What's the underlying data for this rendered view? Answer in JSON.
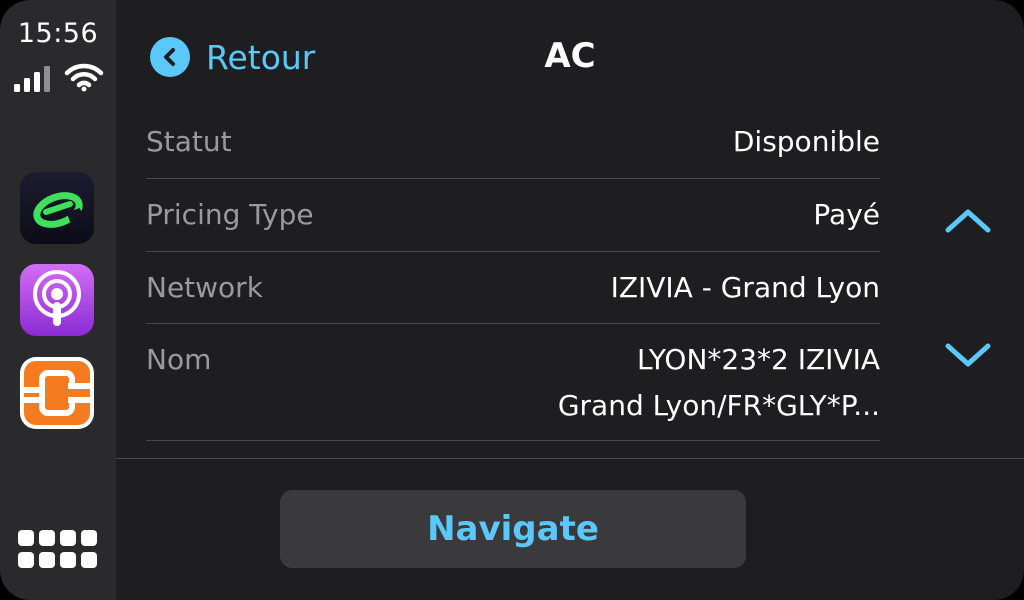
{
  "status_bar": {
    "time": "15:56",
    "signal_icon": "cellular-signal-icon",
    "wifi_icon": "wifi-icon"
  },
  "sidebar": {
    "apps": [
      {
        "icon": "chargemap-app-icon"
      },
      {
        "icon": "podcasts-app-icon"
      },
      {
        "icon": "charging-app-icon"
      }
    ],
    "dashboard_icon": "dashboard-grid-icon"
  },
  "header": {
    "back_label": "Retour",
    "title": "AC"
  },
  "details": [
    {
      "label": "Statut",
      "value": "Disponible"
    },
    {
      "label": "Pricing Type",
      "value": "Payé"
    },
    {
      "label": "Network",
      "value": "IZIVIA - Grand Lyon"
    },
    {
      "label": "Nom",
      "value_line1": "LYON*23*2 IZIVIA",
      "value_line2": "Grand Lyon/FR*GLY*P..."
    }
  ],
  "actions": {
    "navigate_label": "Navigate"
  },
  "colors": {
    "accent": "#5ac8fa",
    "background": "#1e1e20",
    "sidebar": "#2a2a2c"
  }
}
